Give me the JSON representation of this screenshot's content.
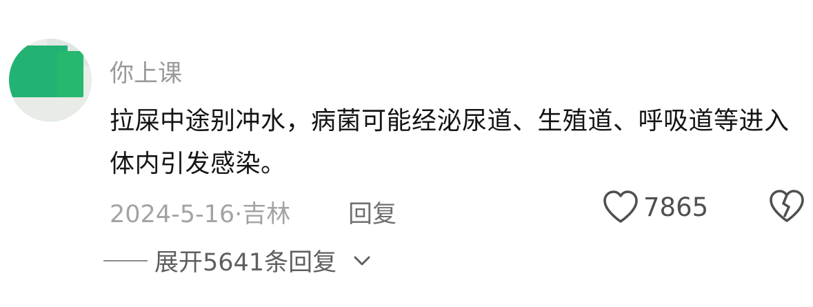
{
  "comment": {
    "username": "你上课",
    "text": "拉屎中途别冲水，病菌可能经泌尿道、生殖道、呼吸道等进入体内引发感染。",
    "meta": "2024-5-16·吉林",
    "reply_label": "回复",
    "like_count": "7865",
    "expand_label": "展开5641条回复"
  },
  "icons": {
    "like": "heart-outline-icon",
    "dislike": "broken-heart-icon",
    "expand": "chevron-down-icon"
  },
  "colors": {
    "username": "#9a9a9a",
    "text": "#141414",
    "meta": "#a3a3a3",
    "icon": "#4f4f4f"
  }
}
